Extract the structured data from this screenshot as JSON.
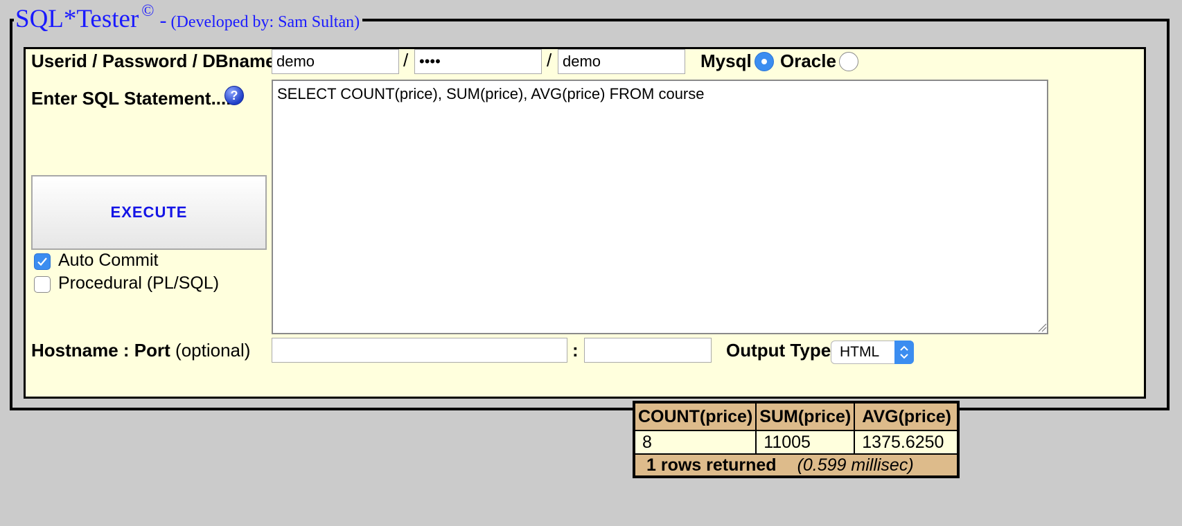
{
  "header": {
    "title": "SQL*Tester",
    "copyright": "©",
    "separator": "-",
    "developer": "(Developed by: Sam Sultan)"
  },
  "login": {
    "label": "Userid / Password / DBname",
    "userid": "demo",
    "password": "••••",
    "dbname": "demo",
    "separator": "/"
  },
  "db_type": {
    "mysql_label": "Mysql",
    "oracle_label": "Oracle",
    "selected": "Mysql"
  },
  "sql": {
    "label": "Enter SQL Statement....",
    "help_icon": "help-icon",
    "statement": "SELECT COUNT(price), SUM(price), AVG(price) FROM course"
  },
  "execute": {
    "label": "EXECUTE"
  },
  "options": {
    "auto_commit_label": "Auto Commit",
    "auto_commit_checked": true,
    "procedural_label": "Procedural (PL/SQL)",
    "procedural_checked": false
  },
  "host": {
    "label_bold": "Hostname : Port",
    "label_normal": "(optional)",
    "hostname": "",
    "port": "",
    "separator": ":"
  },
  "output": {
    "label": "Output Type",
    "selected": "HTML"
  },
  "result": {
    "columns": [
      "COUNT(price)",
      "SUM(price)",
      "AVG(price)"
    ],
    "rows": [
      [
        "8",
        "11005",
        "1375.6250"
      ]
    ],
    "rows_returned": "1 rows returned",
    "timing": "(0.599 millisec)"
  },
  "colors": {
    "background": "#cbcbcb",
    "panel": "#ffffdd",
    "accent_blue": "#1a1aff",
    "table_header": "#ddbb8b",
    "control_blue": "#3b8df0"
  }
}
